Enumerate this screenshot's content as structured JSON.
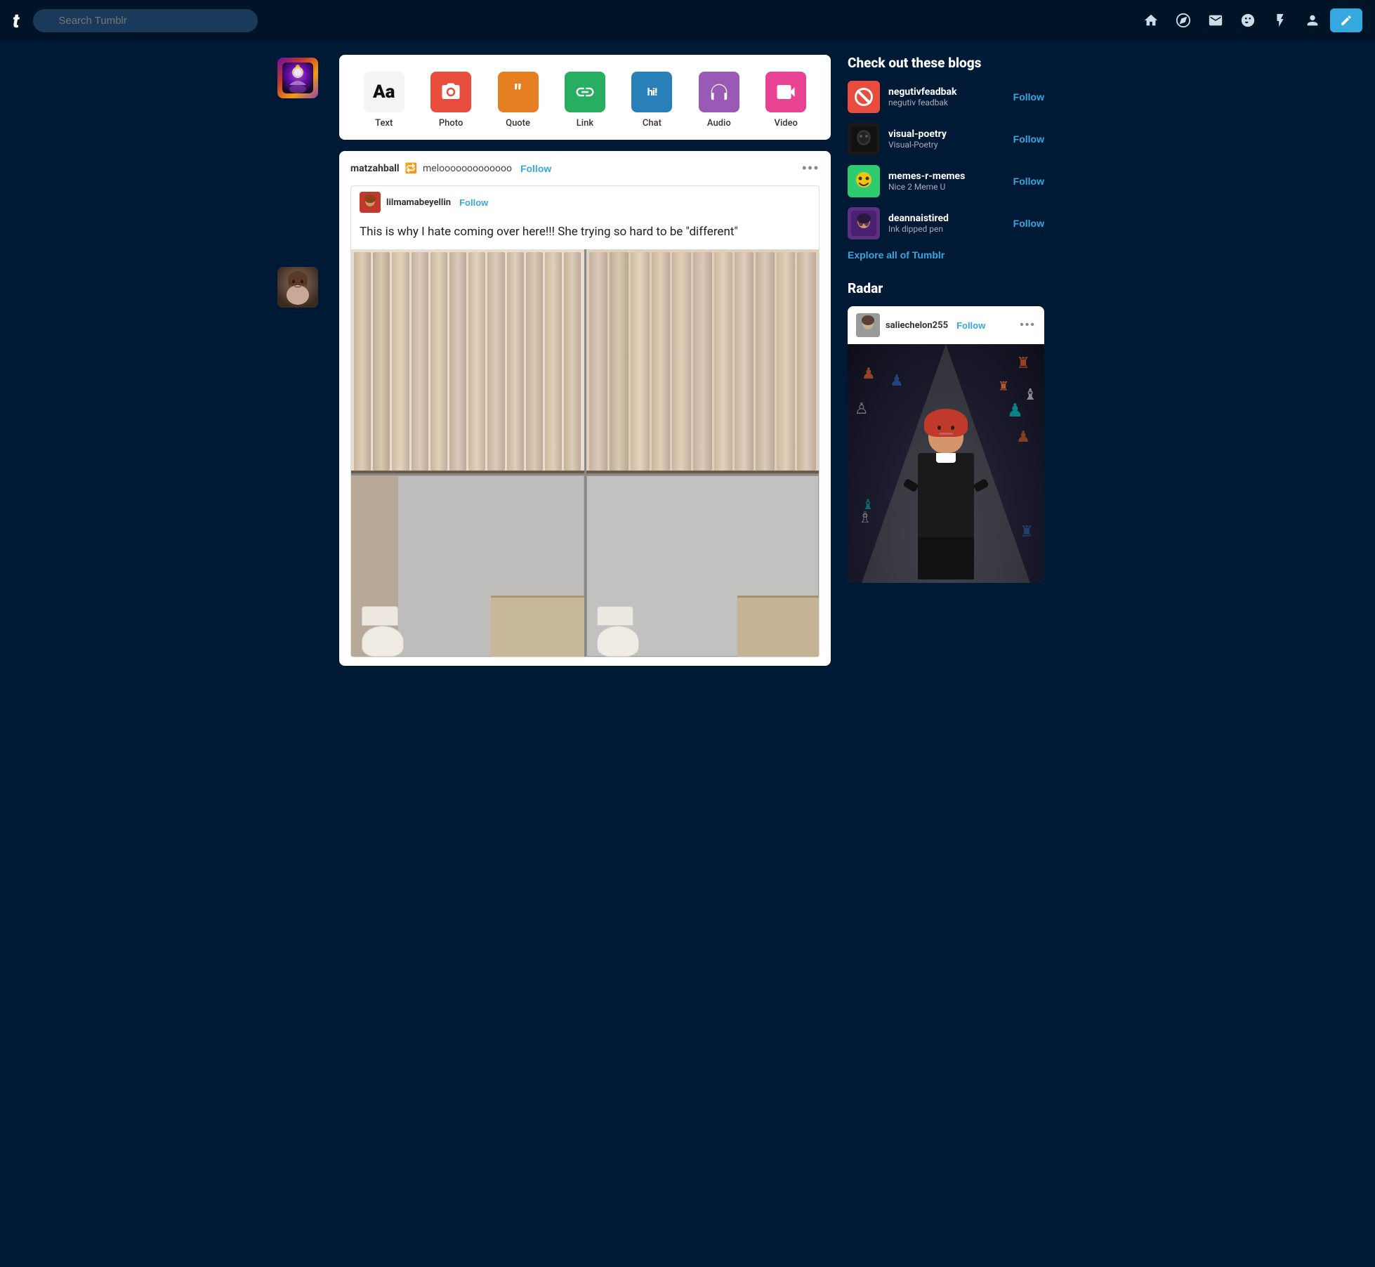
{
  "navbar": {
    "logo": "t",
    "search_placeholder": "Search Tumblr",
    "icons": {
      "home": "🏠",
      "explore": "🧭",
      "mail": "✉",
      "emoji": "😊",
      "activity": "⚡",
      "account": "👤",
      "compose": "✏️"
    }
  },
  "post_types": [
    {
      "id": "text",
      "label": "Text",
      "icon": "Aa",
      "class": "icon-text"
    },
    {
      "id": "photo",
      "label": "Photo",
      "icon": "📷",
      "class": "icon-photo"
    },
    {
      "id": "quote",
      "label": "Quote",
      "icon": "❝❞",
      "class": "icon-quote"
    },
    {
      "id": "link",
      "label": "Link",
      "icon": "🔗",
      "class": "icon-link"
    },
    {
      "id": "chat",
      "label": "Chat",
      "icon": "hi!",
      "class": "icon-chat"
    },
    {
      "id": "audio",
      "label": "Audio",
      "icon": "🎧",
      "class": "icon-audio"
    },
    {
      "id": "video",
      "label": "Video",
      "icon": "🎥",
      "class": "icon-video"
    }
  ],
  "post": {
    "author": "matzahball",
    "reblog_icon": "🔁",
    "reblogger": "melooooooooooooo",
    "follow_label": "Follow",
    "more_icon": "•••",
    "inner": {
      "username": "lilmamabeyellin",
      "follow_label": "Follow",
      "text": "This is why I hate coming over here!!! She trying so hard to be \"different\""
    }
  },
  "sidebar": {
    "blogs_title": "Check out these blogs",
    "blogs": [
      {
        "name": "negutivfeadbak",
        "tagline": "negutiv feadbak",
        "follow": "Follow",
        "bg": "#e74c3c",
        "icon": "🚫"
      },
      {
        "name": "visual-poetry",
        "tagline": "Visual-Poetry",
        "follow": "Follow",
        "bg": "#1a1a1a",
        "icon": "🖤"
      },
      {
        "name": "memes-r-memes",
        "tagline": "Nice 2 Meme U",
        "follow": "Follow",
        "bg": "#f1c40f",
        "icon": "😀"
      },
      {
        "name": "deannaistired",
        "tagline": "Ink dipped pen",
        "follow": "Follow",
        "bg": "#6a0dad",
        "icon": "🎨"
      }
    ],
    "explore_label": "Explore all of Tumblr",
    "radar_title": "Radar",
    "radar": {
      "username": "saliechelon255",
      "follow_label": "Follow",
      "more_icon": "•••"
    }
  }
}
